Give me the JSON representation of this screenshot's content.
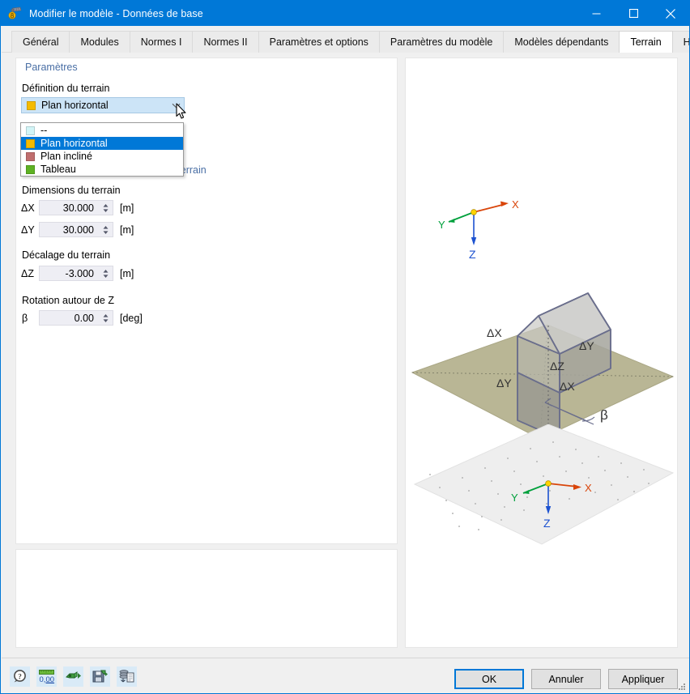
{
  "window": {
    "title": "Modifier le modèle - Données de base",
    "icon": "rfem-model-icon",
    "controls": {
      "minimize": "minimize-icon",
      "maximize": "maximize-icon",
      "close": "close-icon"
    },
    "accent_color": "#0078d7"
  },
  "tabs": [
    {
      "label": "Général",
      "active": false
    },
    {
      "label": "Modules",
      "active": false
    },
    {
      "label": "Normes I",
      "active": false
    },
    {
      "label": "Normes II",
      "active": false
    },
    {
      "label": "Paramètres et options",
      "active": false
    },
    {
      "label": "Paramètres du modèle",
      "active": false
    },
    {
      "label": "Modèles dépendants",
      "active": false
    },
    {
      "label": "Terrain",
      "active": true
    },
    {
      "label": "Historique",
      "active": false
    }
  ],
  "left_panel": {
    "group_parametres": "Paramètres",
    "label_definition": "Définition du terrain",
    "combo": {
      "value": "Plan horizontal",
      "swatch_color": "#f5bb00",
      "arrow_icon": "chevron-down-icon",
      "open": true,
      "options": [
        {
          "label": "--",
          "swatch_color": "#d2f5f7",
          "selected": false
        },
        {
          "label": "Plan horizontal",
          "swatch_color": "#f5bb00",
          "selected": true
        },
        {
          "label": "Plan incliné",
          "swatch_color": "#c06e6e",
          "selected": false
        },
        {
          "label": "Tableau",
          "swatch_color": "#5eb223",
          "selected": false
        }
      ]
    },
    "group_consideration": "Considération des dimensions du terrain",
    "group_dimensions": "Dimensions du terrain",
    "fields": [
      {
        "symbol": "ΔX",
        "value": "30.000",
        "unit": "[m]"
      },
      {
        "symbol": "ΔY",
        "value": "30.000",
        "unit": "[m]"
      }
    ],
    "group_decalage": "Décalage du terrain",
    "field_dz": {
      "symbol": "ΔZ",
      "value": "-3.000",
      "unit": "[m]"
    },
    "group_rotation": "Rotation autour de Z",
    "field_beta": {
      "symbol": "β",
      "value": "0.00",
      "unit": "[deg]"
    }
  },
  "graphic": {
    "axes_top": {
      "x": "X",
      "y": "Y",
      "z": "Z"
    },
    "axes_bottom": {
      "x": "X",
      "y": "Y",
      "z": "Z"
    },
    "annotations": {
      "dx_left": "ΔX",
      "dy_right": "ΔY",
      "dy_left": "ΔY",
      "dx_bottom": "ΔX",
      "beta": "β",
      "dz": "ΔZ"
    },
    "colors": {
      "axis_x": "#d9450a",
      "axis_y": "#00a03c",
      "axis_z": "#1d52d0",
      "origin": "#ffd400",
      "terrain_plane": "#b9b695",
      "offset_plane": "#eeeeee",
      "building": "#6a6e8c"
    }
  },
  "statusbar": {
    "tools": [
      {
        "name": "help-info-icon",
        "title": "Info"
      },
      {
        "name": "units-decimal-icon",
        "title": "Unités et décimales"
      },
      {
        "name": "import-icon",
        "title": "Importer"
      },
      {
        "name": "save-as-default-icon",
        "title": "Enregistrer par défaut"
      },
      {
        "name": "copy-from-model-icon",
        "title": "Copier depuis le modèle"
      }
    ],
    "buttons": {
      "ok": "OK",
      "cancel": "Annuler",
      "apply": "Appliquer"
    },
    "grip": "resize-grip-icon"
  }
}
